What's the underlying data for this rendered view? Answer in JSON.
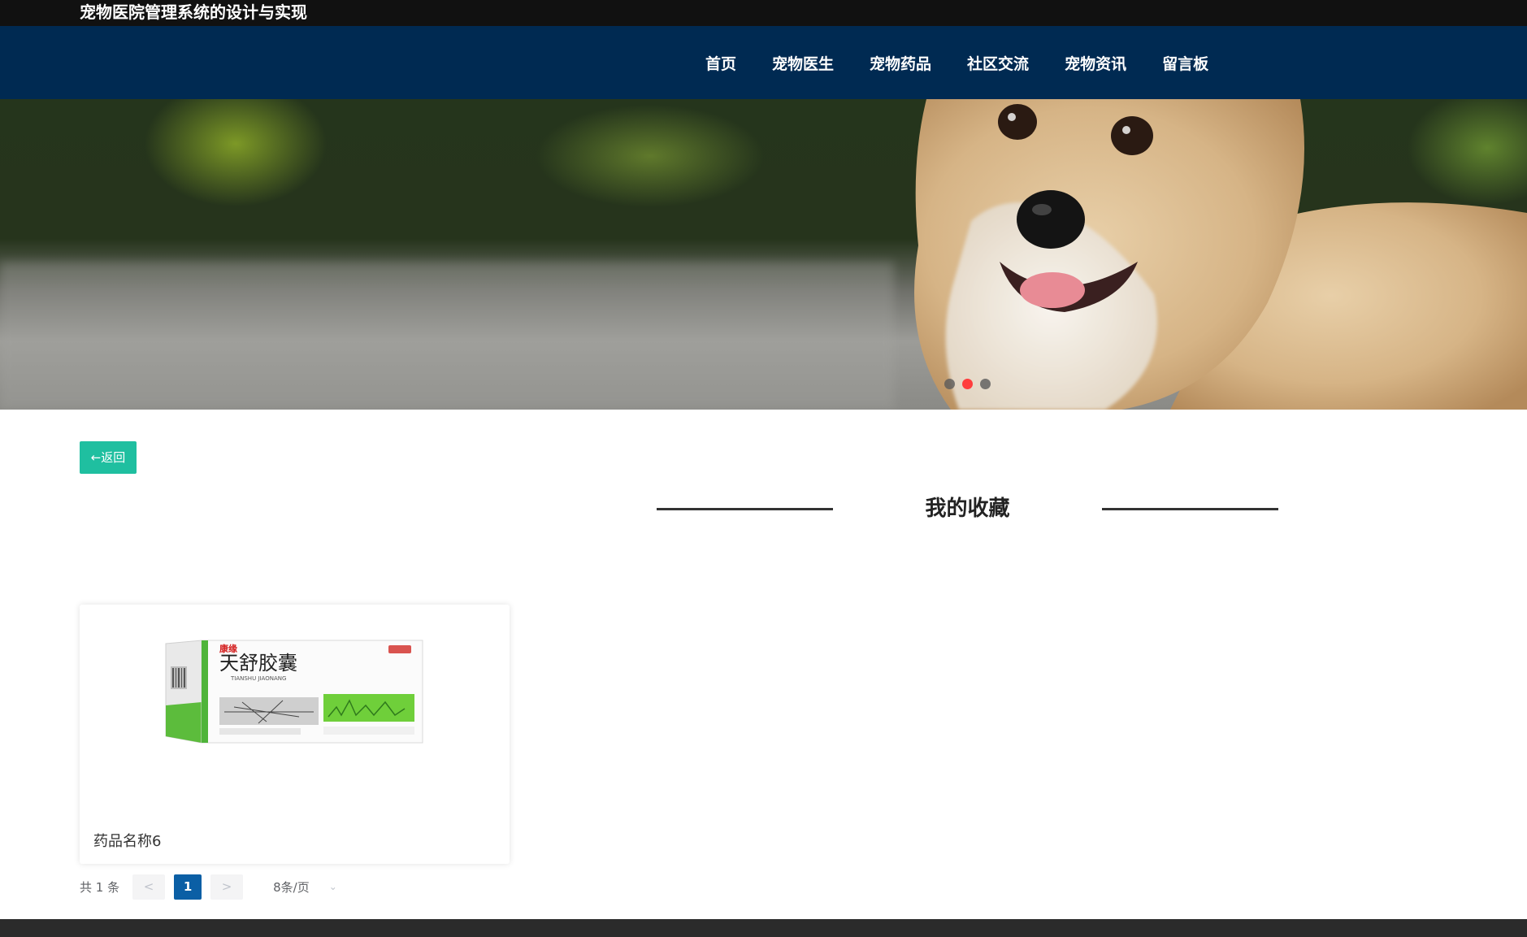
{
  "header": {
    "site_title": "宠物医院管理系统的设计与实现"
  },
  "nav": {
    "items": [
      {
        "label": "首页"
      },
      {
        "label": "宠物医生"
      },
      {
        "label": "宠物药品"
      },
      {
        "label": "社区交流"
      },
      {
        "label": "宠物资讯"
      },
      {
        "label": "留言板"
      }
    ]
  },
  "banner": {
    "slide_count": 3,
    "active_slide": 2
  },
  "actions": {
    "back_label": "←返回"
  },
  "section": {
    "title": "我的收藏"
  },
  "favorites": [
    {
      "name": "药品名称6",
      "image": "medicine-box-tianshu"
    }
  ],
  "product_box": {
    "brand": "康缘",
    "name_cn": "天舒胶囊",
    "name_pinyin": "TIANSHU JIAONANG"
  },
  "pagination": {
    "total_label": "共 1 条",
    "prev": "<",
    "current_page": "1",
    "next": ">",
    "page_size_label": "8条/页"
  },
  "colors": {
    "topbar": "#111111",
    "navbar": "#002a52",
    "back_button": "#1fbfa0",
    "active_page": "#0b5fa5",
    "active_dot": "#ff3d3d",
    "footer": "#2b2b2b"
  }
}
